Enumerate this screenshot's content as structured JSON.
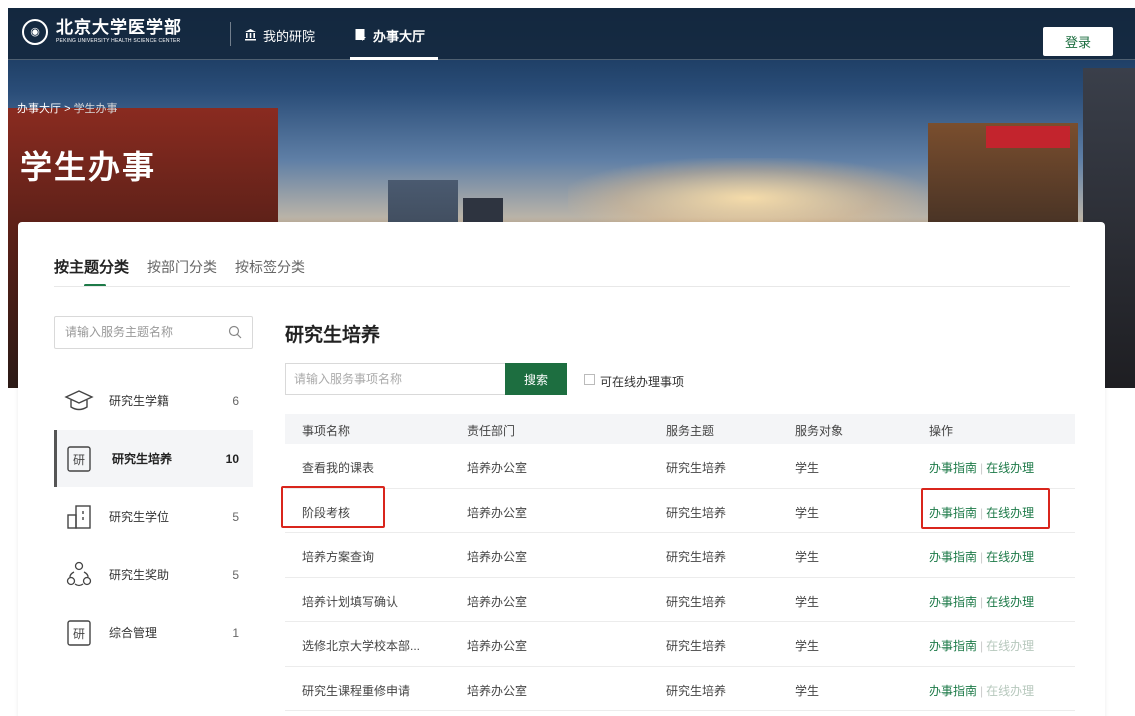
{
  "brand": {
    "name_cn": "北京大学医学部",
    "name_en": "PEKING UNIVERSITY HEALTH SCIENCE CENTER"
  },
  "nav": {
    "items": [
      {
        "label": "我的研院",
        "icon": "institution-icon"
      },
      {
        "label": "办事大厅",
        "icon": "document-icon",
        "active": true
      }
    ],
    "login_label": "登录"
  },
  "breadcrumb": {
    "parent": "办事大厅",
    "separator": ">",
    "current": "学生办事"
  },
  "hero_title": "学生办事",
  "tabs": [
    "按主题分类",
    "按部门分类",
    "按标签分类"
  ],
  "sidebar": {
    "search_placeholder": "请输入服务主题名称",
    "items": [
      {
        "label": "研究生学籍",
        "count": "6",
        "icon": "graduation-cap-icon"
      },
      {
        "label": "研究生培养",
        "count": "10",
        "icon": "yan-character-icon",
        "active": true
      },
      {
        "label": "研究生学位",
        "count": "5",
        "icon": "building-icon"
      },
      {
        "label": "研究生奖助",
        "count": "5",
        "icon": "people-icon"
      },
      {
        "label": "综合管理",
        "count": "1",
        "icon": "yan-character-icon"
      }
    ]
  },
  "main": {
    "title": "研究生培养",
    "search_placeholder": "请输入服务事项名称",
    "search_button": "搜索",
    "online_filter_label": "可在线办理事项",
    "columns": [
      "事项名称",
      "责任部门",
      "服务主题",
      "服务对象",
      "操作"
    ],
    "rows": [
      {
        "name": "查看我的课表",
        "dept": "培养办公室",
        "topic": "研究生培养",
        "target": "学生",
        "guide": "办事指南",
        "sep": "|",
        "online": "在线办理",
        "online_enabled": true
      },
      {
        "name": "阶段考核",
        "dept": "培养办公室",
        "topic": "研究生培养",
        "target": "学生",
        "guide": "办事指南",
        "sep": "|",
        "online": "在线办理",
        "online_enabled": true
      },
      {
        "name": "培养方案查询",
        "dept": "培养办公室",
        "topic": "研究生培养",
        "target": "学生",
        "guide": "办事指南",
        "sep": "|",
        "online": "在线办理",
        "online_enabled": true
      },
      {
        "name": "培养计划填写确认",
        "dept": "培养办公室",
        "topic": "研究生培养",
        "target": "学生",
        "guide": "办事指南",
        "sep": "|",
        "online": "在线办理",
        "online_enabled": true
      },
      {
        "name": "选修北京大学校本部...",
        "dept": "培养办公室",
        "topic": "研究生培养",
        "target": "学生",
        "guide": "办事指南",
        "sep": "|",
        "online": "在线办理",
        "online_enabled": false
      },
      {
        "name": "研究生课程重修申请",
        "dept": "培养办公室",
        "topic": "研究生培养",
        "target": "学生",
        "guide": "办事指南",
        "sep": "|",
        "online": "在线办理",
        "online_enabled": false
      }
    ]
  },
  "colors": {
    "accent": "#1d6e40",
    "highlight": "#d9251c"
  }
}
